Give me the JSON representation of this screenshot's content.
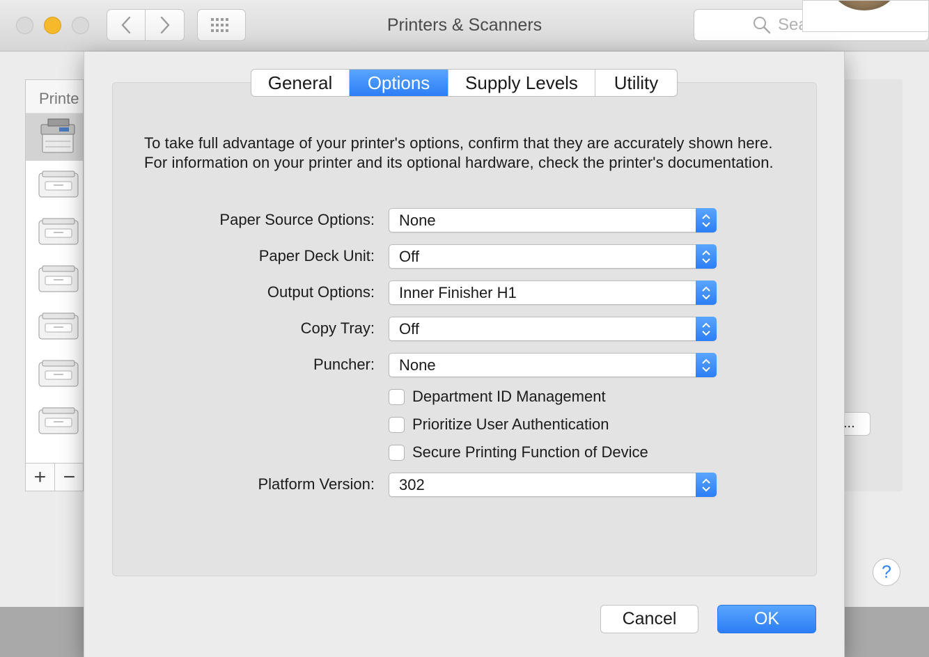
{
  "window": {
    "title": "Printers & Scanners",
    "search_placeholder": "Search",
    "search_visible": "Sea"
  },
  "sidebar": {
    "header": "Printers",
    "header_visible": "Printe",
    "add_label": "+",
    "remove_label": "−"
  },
  "background": {
    "partial_button_visible": "s...",
    "help_label": "?"
  },
  "sheet": {
    "tabs": [
      {
        "label": "General",
        "selected": false
      },
      {
        "label": "Options",
        "selected": true
      },
      {
        "label": "Supply Levels",
        "selected": false
      },
      {
        "label": "Utility",
        "selected": false
      }
    ],
    "intro": "To take full advantage of your printer's options, confirm that they are accurately shown here. For information on your printer and its optional hardware, check the printer's documentation.",
    "options": {
      "paper_source": {
        "label": "Paper Source Options:",
        "value": "None"
      },
      "paper_deck": {
        "label": "Paper Deck Unit:",
        "value": "Off"
      },
      "output": {
        "label": "Output Options:",
        "value": "Inner Finisher H1"
      },
      "copy_tray": {
        "label": "Copy Tray:",
        "value": "Off"
      },
      "puncher": {
        "label": "Puncher:",
        "value": "None"
      },
      "platform": {
        "label": "Platform Version:",
        "value": "302"
      }
    },
    "checkboxes": [
      {
        "label": "Department ID Management",
        "checked": false
      },
      {
        "label": "Prioritize User Authentication",
        "checked": false
      },
      {
        "label": "Secure Printing Function of Device",
        "checked": false
      }
    ],
    "buttons": {
      "cancel": "Cancel",
      "ok": "OK"
    }
  },
  "colors": {
    "accent": "#2c7ef6",
    "close_light": "#d9d9d9",
    "minimize_light": "#f5b92b"
  }
}
